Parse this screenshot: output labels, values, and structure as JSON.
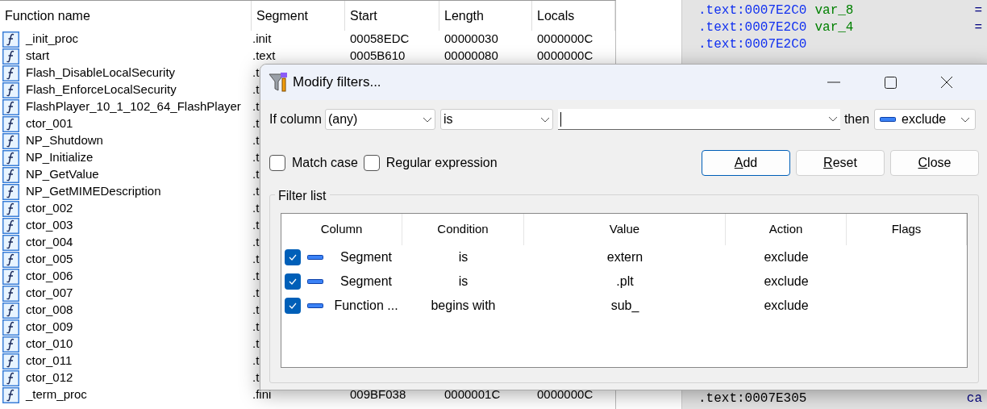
{
  "functions": {
    "columns": [
      "Function name",
      "Segment",
      "Start",
      "Length",
      "Locals"
    ],
    "rows": [
      {
        "name": "_init_proc",
        "segment": ".init",
        "start": "00058EDC",
        "length": "00000030",
        "locals": "0000000C"
      },
      {
        "name": "start",
        "segment": ".text",
        "start": "0005B610",
        "length": "00000080",
        "locals": "0000000C"
      },
      {
        "name": "Flash_DisableLocalSecurity",
        "segment": ".t"
      },
      {
        "name": "Flash_EnforceLocalSecurity",
        "segment": ".t"
      },
      {
        "name": "FlashPlayer_10_1_102_64_FlashPlayer",
        "segment": ".t"
      },
      {
        "name": "ctor_001",
        "segment": ".t"
      },
      {
        "name": "NP_Shutdown",
        "segment": ".t"
      },
      {
        "name": "NP_Initialize",
        "segment": ".t"
      },
      {
        "name": "NP_GetValue",
        "segment": ".t"
      },
      {
        "name": "NP_GetMIMEDescription",
        "segment": ".t"
      },
      {
        "name": "ctor_002",
        "segment": ".t"
      },
      {
        "name": "ctor_003",
        "segment": ".t"
      },
      {
        "name": "ctor_004",
        "segment": ".t"
      },
      {
        "name": "ctor_005",
        "segment": ".t"
      },
      {
        "name": "ctor_006",
        "segment": ".t"
      },
      {
        "name": "ctor_007",
        "segment": ".t"
      },
      {
        "name": "ctor_008",
        "segment": ".t"
      },
      {
        "name": "ctor_009",
        "segment": ".t"
      },
      {
        "name": "ctor_010",
        "segment": ".t"
      },
      {
        "name": "ctor_011",
        "segment": ".t"
      },
      {
        "name": "ctor_012",
        "segment": ".t"
      },
      {
        "name": "_term_proc",
        "segment": ".fini",
        "start": "009BF038",
        "length": "0000001C",
        "locals": "0000000C"
      }
    ]
  },
  "disassembly": {
    "top_lines": [
      {
        "address": ".text:0007E2C0",
        "name": "var_8",
        "operator": "="
      },
      {
        "address": ".text:0007E2C0",
        "name": "var_4",
        "operator": "="
      },
      {
        "address": ".text:0007E2C0"
      }
    ],
    "bottom_lines": [
      {
        "address": ".text:0007E305",
        "operator": "ca"
      }
    ]
  },
  "dialog": {
    "title": "Modify filters...",
    "if_label": "If column",
    "column_select": "(any)",
    "condition_select": "is",
    "then_label": "then",
    "action_select": "exclude",
    "options": [
      {
        "label": "Match case",
        "checked": false
      },
      {
        "label": "Regular expression",
        "checked": false
      }
    ],
    "buttons": [
      {
        "label": "Add",
        "default": true,
        "mnemonic": true
      },
      {
        "label": "Reset",
        "default": false,
        "mnemonic": true
      },
      {
        "label": "Close",
        "default": false,
        "mnemonic": true
      }
    ],
    "filter_list": {
      "title": "Filter list",
      "columns": [
        "Column",
        "Condition",
        "Value",
        "Action",
        "Flags"
      ],
      "rows": [
        {
          "enabled": true,
          "column": "Segment",
          "condition": "is",
          "value": "extern",
          "action": "exclude"
        },
        {
          "enabled": true,
          "column": "Segment",
          "condition": "is",
          "value": ".plt",
          "action": "exclude"
        },
        {
          "enabled": true,
          "column": "Function ...",
          "condition": "begins with",
          "value": "sub_",
          "action": "exclude"
        }
      ]
    }
  }
}
